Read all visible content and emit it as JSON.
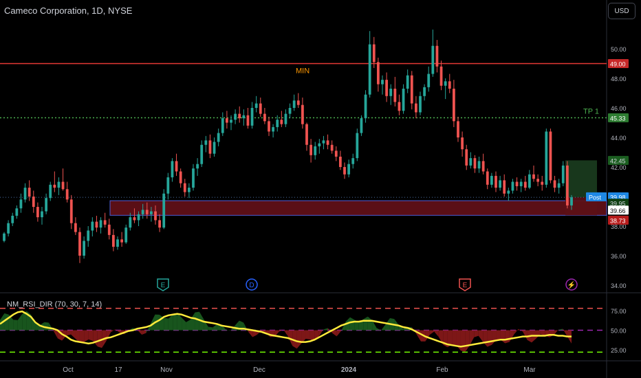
{
  "header": {
    "title": "Cameco Corporation, 1D, NYSE",
    "currency_button": "USD"
  },
  "annotations": {
    "min_label": "MIN",
    "tp_label": "TP 1"
  },
  "colors": {
    "up": "#26a69a",
    "down": "#ef5350",
    "red_line": "#e53935",
    "green_dotted": "#4caf50",
    "zone_fill": "#5a0f16",
    "zone_border": "#4a5fd8",
    "rsi_line": "#ffeb3b"
  },
  "price_axis": {
    "ticks": [
      "50.00",
      "48.00",
      "46.00",
      "44.00",
      "42.00",
      "38.00",
      "36.00",
      "34.00"
    ]
  },
  "price_labels": {
    "min_line": "49.00",
    "tp_line": "45.33",
    "target": "42.45",
    "post_tag": "Post",
    "post_value": "39.98",
    "last_close": "39.95",
    "current": "39.66",
    "stop": "38.73"
  },
  "indicator": {
    "title": "NM_RSI_DIR (70, 30, 7, 14)",
    "ticks": [
      "75.00",
      "50.00",
      "25.00"
    ]
  },
  "time_axis": {
    "labels": [
      "Oct",
      "17",
      "Nov",
      "Dec",
      "2024",
      "Feb",
      "Mar"
    ]
  },
  "events": [
    {
      "letter": "E",
      "color": "#26a69a"
    },
    {
      "letter": "D",
      "color": "#2962ff"
    },
    {
      "letter": "E",
      "color": "#ef5350"
    },
    {
      "letter": "⚡",
      "color": "#9c27b0"
    }
  ],
  "chart_data": {
    "type": "candlestick",
    "title": "Cameco Corporation, 1D, NYSE",
    "ylim": [
      33.5,
      52.0
    ],
    "levels": {
      "min": 49.0,
      "tp1": 45.33,
      "target": 42.45,
      "stop": 38.73,
      "last_close": 39.95
    },
    "zone": {
      "low": 38.73,
      "high": 39.72
    },
    "candles": [
      [
        37.0,
        37.6,
        36.9,
        37.5
      ],
      [
        37.5,
        38.4,
        37.3,
        38.2
      ],
      [
        38.2,
        38.9,
        38.0,
        38.7
      ],
      [
        38.7,
        39.4,
        38.5,
        39.2
      ],
      [
        39.2,
        40.2,
        38.9,
        39.8
      ],
      [
        39.8,
        40.9,
        39.6,
        40.6
      ],
      [
        40.6,
        41.1,
        39.7,
        40.0
      ],
      [
        40.0,
        40.4,
        38.9,
        39.3
      ],
      [
        39.3,
        39.6,
        38.3,
        38.6
      ],
      [
        38.6,
        39.3,
        38.1,
        39.0
      ],
      [
        39.0,
        40.2,
        38.8,
        39.9
      ],
      [
        39.9,
        41.0,
        39.7,
        40.8
      ],
      [
        40.8,
        41.7,
        40.3,
        40.6
      ],
      [
        40.6,
        41.3,
        40.1,
        41.0
      ],
      [
        41.0,
        41.9,
        40.4,
        40.5
      ],
      [
        40.5,
        41.0,
        39.6,
        39.8
      ],
      [
        39.8,
        40.1,
        37.8,
        38.2
      ],
      [
        38.2,
        38.6,
        37.4,
        37.6
      ],
      [
        37.6,
        37.9,
        35.5,
        36.0
      ],
      [
        36.0,
        37.3,
        35.8,
        37.0
      ],
      [
        37.0,
        38.0,
        36.6,
        37.7
      ],
      [
        37.7,
        38.6,
        37.3,
        38.3
      ],
      [
        38.3,
        38.7,
        37.6,
        37.9
      ],
      [
        37.9,
        38.6,
        37.5,
        38.4
      ],
      [
        38.4,
        38.9,
        37.9,
        38.1
      ],
      [
        38.1,
        38.5,
        37.1,
        37.4
      ],
      [
        37.4,
        37.8,
        36.3,
        36.6
      ],
      [
        36.6,
        37.3,
        36.4,
        37.1
      ],
      [
        37.1,
        37.6,
        36.6,
        36.9
      ],
      [
        36.9,
        38.1,
        36.8,
        37.9
      ],
      [
        37.9,
        38.9,
        37.7,
        38.6
      ],
      [
        38.6,
        39.2,
        38.2,
        38.4
      ],
      [
        38.4,
        39.0,
        38.0,
        38.8
      ],
      [
        38.8,
        39.5,
        38.5,
        39.1
      ],
      [
        39.1,
        39.6,
        38.5,
        38.8
      ],
      [
        38.8,
        39.3,
        38.3,
        39.0
      ],
      [
        39.0,
        39.4,
        38.1,
        38.4
      ],
      [
        38.4,
        38.8,
        37.6,
        37.9
      ],
      [
        37.9,
        40.5,
        37.8,
        40.2
      ],
      [
        40.2,
        41.6,
        39.8,
        41.3
      ],
      [
        41.3,
        42.6,
        41.0,
        42.4
      ],
      [
        42.4,
        42.9,
        41.4,
        41.7
      ],
      [
        41.7,
        41.9,
        40.6,
        40.9
      ],
      [
        40.9,
        41.2,
        40.0,
        40.3
      ],
      [
        40.3,
        40.9,
        39.9,
        40.6
      ],
      [
        40.6,
        42.2,
        40.4,
        41.9
      ],
      [
        41.9,
        42.6,
        41.4,
        42.2
      ],
      [
        42.2,
        43.8,
        42.0,
        43.5
      ],
      [
        43.5,
        44.1,
        43.0,
        43.8
      ],
      [
        43.8,
        44.2,
        42.6,
        42.9
      ],
      [
        42.9,
        44.0,
        42.7,
        43.7
      ],
      [
        43.7,
        44.6,
        43.4,
        44.3
      ],
      [
        44.3,
        45.7,
        44.1,
        45.3
      ],
      [
        45.3,
        45.8,
        44.6,
        45.0
      ],
      [
        45.0,
        45.5,
        44.5,
        45.2
      ],
      [
        45.2,
        45.9,
        44.9,
        45.6
      ],
      [
        45.6,
        46.1,
        45.0,
        45.3
      ],
      [
        45.3,
        45.9,
        44.8,
        45.5
      ],
      [
        45.5,
        46.0,
        44.6,
        44.8
      ],
      [
        44.8,
        46.4,
        44.6,
        46.0
      ],
      [
        46.0,
        46.8,
        45.7,
        46.3
      ],
      [
        46.3,
        46.7,
        45.4,
        45.6
      ],
      [
        45.6,
        46.0,
        44.9,
        45.1
      ],
      [
        45.1,
        45.4,
        44.1,
        44.4
      ],
      [
        44.4,
        44.9,
        44.0,
        44.7
      ],
      [
        44.7,
        45.5,
        44.4,
        45.2
      ],
      [
        45.2,
        45.8,
        44.7,
        44.9
      ],
      [
        44.9,
        45.9,
        44.7,
        45.6
      ],
      [
        45.6,
        46.3,
        45.3,
        46.0
      ],
      [
        46.0,
        46.9,
        45.8,
        46.5
      ],
      [
        46.5,
        47.0,
        46.0,
        46.2
      ],
      [
        46.2,
        46.7,
        44.6,
        44.9
      ],
      [
        44.9,
        45.0,
        43.1,
        43.5
      ],
      [
        43.5,
        43.9,
        42.3,
        42.8
      ],
      [
        42.8,
        43.7,
        42.5,
        43.4
      ],
      [
        43.4,
        43.9,
        42.9,
        43.6
      ],
      [
        43.6,
        44.1,
        43.2,
        43.8
      ],
      [
        43.8,
        44.2,
        43.2,
        43.5
      ],
      [
        43.5,
        43.8,
        42.9,
        43.1
      ],
      [
        43.1,
        43.4,
        42.4,
        42.7
      ],
      [
        42.7,
        43.1,
        41.8,
        42.0
      ],
      [
        42.0,
        42.3,
        41.2,
        41.5
      ],
      [
        41.5,
        42.5,
        41.3,
        42.2
      ],
      [
        42.2,
        42.9,
        41.9,
        42.6
      ],
      [
        42.6,
        44.6,
        42.4,
        44.3
      ],
      [
        44.3,
        45.5,
        44.1,
        45.3
      ],
      [
        45.3,
        47.2,
        45.0,
        46.9
      ],
      [
        46.9,
        51.2,
        46.7,
        50.3
      ],
      [
        50.3,
        50.8,
        48.7,
        49.1
      ],
      [
        49.1,
        49.4,
        47.1,
        47.6
      ],
      [
        47.6,
        48.2,
        46.9,
        47.9
      ],
      [
        47.9,
        48.4,
        46.4,
        46.8
      ],
      [
        46.8,
        47.6,
        46.2,
        47.3
      ],
      [
        47.3,
        48.1,
        46.1,
        46.4
      ],
      [
        46.4,
        46.9,
        45.5,
        45.8
      ],
      [
        45.8,
        47.6,
        45.6,
        47.3
      ],
      [
        47.3,
        48.6,
        47.0,
        48.2
      ],
      [
        48.2,
        48.5,
        45.9,
        46.3
      ],
      [
        46.3,
        46.8,
        45.3,
        45.7
      ],
      [
        45.7,
        47.1,
        45.5,
        46.8
      ],
      [
        46.8,
        47.6,
        46.5,
        47.4
      ],
      [
        47.4,
        48.8,
        47.1,
        48.3
      ],
      [
        48.3,
        51.3,
        48.1,
        50.2
      ],
      [
        50.2,
        50.6,
        48.4,
        48.8
      ],
      [
        48.8,
        49.2,
        47.2,
        47.5
      ],
      [
        47.5,
        48.0,
        46.6,
        47.8
      ],
      [
        47.8,
        48.3,
        47.0,
        47.3
      ],
      [
        47.3,
        47.9,
        44.7,
        45.1
      ],
      [
        45.1,
        45.4,
        43.7,
        44.0
      ],
      [
        44.0,
        44.4,
        42.7,
        43.2
      ],
      [
        43.2,
        43.5,
        41.8,
        42.1
      ],
      [
        42.1,
        43.0,
        41.9,
        42.6
      ],
      [
        42.6,
        42.8,
        41.6,
        41.9
      ],
      [
        41.9,
        42.7,
        41.6,
        42.4
      ],
      [
        42.4,
        42.9,
        41.5,
        41.7
      ],
      [
        41.7,
        41.9,
        40.5,
        40.8
      ],
      [
        40.8,
        41.6,
        40.6,
        41.4
      ],
      [
        41.4,
        41.7,
        40.3,
        40.6
      ],
      [
        40.6,
        41.4,
        40.4,
        41.1
      ],
      [
        41.1,
        41.5,
        40.0,
        40.2
      ],
      [
        40.2,
        40.6,
        39.7,
        40.4
      ],
      [
        40.4,
        41.2,
        40.2,
        41.0
      ],
      [
        41.0,
        41.3,
        40.4,
        40.7
      ],
      [
        40.7,
        41.2,
        40.3,
        41.0
      ],
      [
        41.0,
        41.4,
        40.4,
        40.6
      ],
      [
        40.6,
        41.8,
        40.5,
        41.5
      ],
      [
        41.5,
        42.1,
        41.0,
        41.2
      ],
      [
        41.2,
        41.5,
        40.7,
        41.0
      ],
      [
        41.0,
        41.4,
        40.4,
        40.8
      ],
      [
        40.8,
        44.6,
        40.6,
        44.4
      ],
      [
        44.4,
        44.6,
        40.9,
        41.1
      ],
      [
        41.1,
        41.4,
        40.3,
        40.6
      ],
      [
        40.6,
        41.2,
        40.2,
        40.9
      ],
      [
        40.9,
        42.4,
        40.7,
        42.1
      ],
      [
        42.1,
        42.4,
        39.2,
        39.4
      ],
      [
        39.4,
        40.1,
        39.1,
        39.95
      ]
    ],
    "rsi": [
      58,
      62,
      66,
      70,
      73,
      74,
      71,
      67,
      60,
      56,
      54,
      53,
      52,
      50,
      45,
      42,
      38,
      36,
      35,
      34,
      33,
      34,
      36,
      38,
      40,
      41,
      43,
      45,
      47,
      49,
      50,
      52,
      53,
      54,
      56,
      60,
      63,
      67,
      69,
      70,
      71,
      70,
      68,
      66,
      65,
      63,
      61,
      60,
      59,
      58,
      56,
      55,
      54,
      53,
      52,
      52,
      51,
      50,
      49,
      48,
      46,
      44,
      43,
      42,
      41,
      40,
      38,
      36,
      35,
      35,
      36,
      38,
      41,
      44,
      47,
      50,
      53,
      56,
      58,
      60,
      61,
      61,
      62,
      62,
      62,
      61,
      60,
      59,
      58,
      57,
      56,
      54,
      53,
      51,
      48,
      45,
      42,
      40,
      38,
      36,
      34,
      32,
      31,
      30,
      29,
      30,
      31,
      32,
      33,
      34,
      35,
      36,
      37,
      38,
      38,
      39,
      40,
      41,
      42,
      42,
      43,
      43,
      43,
      43,
      44,
      44,
      43,
      43,
      42,
      42
    ]
  }
}
